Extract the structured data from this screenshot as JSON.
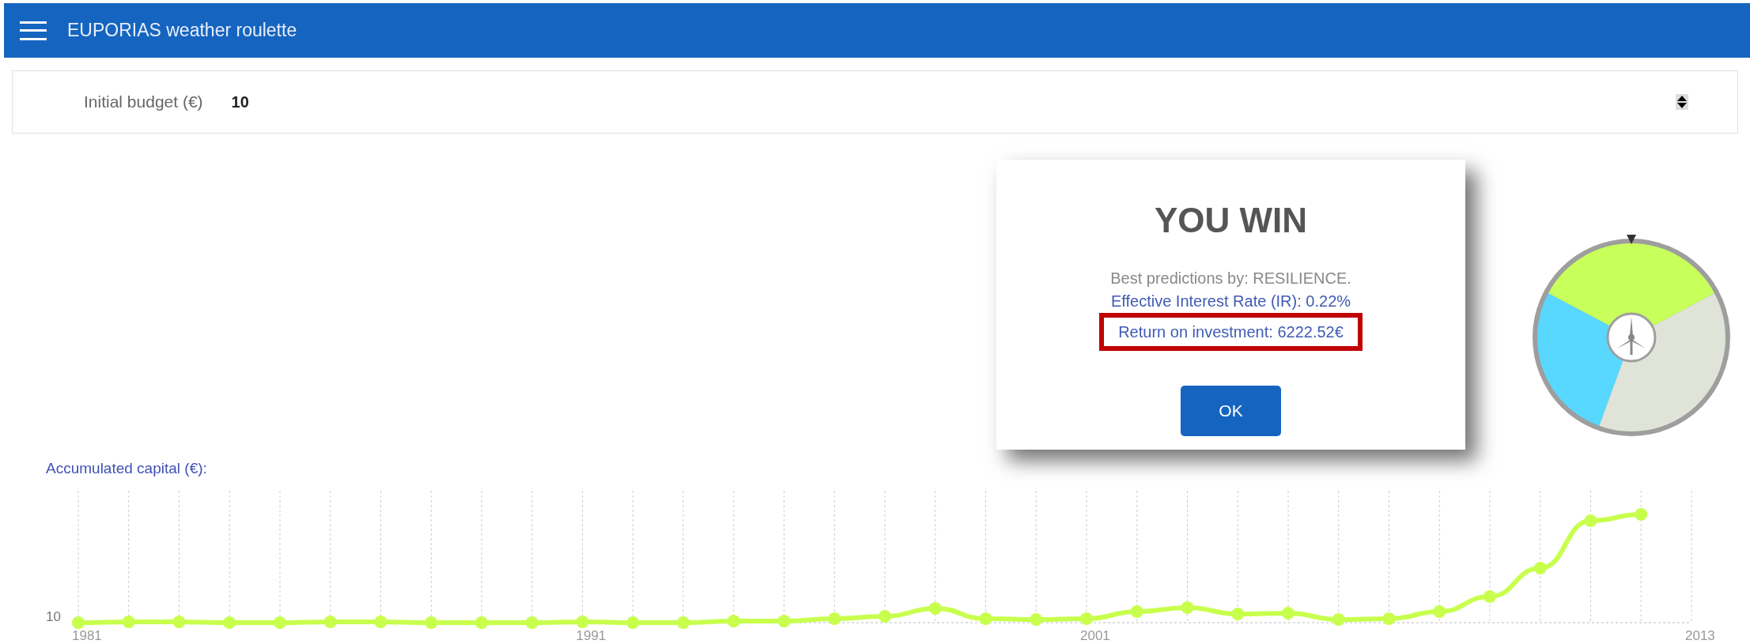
{
  "app_bar": {
    "title": "EUPORIAS weather roulette"
  },
  "budget": {
    "label": "Initial budget (€)",
    "value": "10"
  },
  "dialog": {
    "title": "YOU WIN",
    "lines": [
      {
        "text": "Best predictions by: RESILIENCE.",
        "kind": "note",
        "highlighted": false
      },
      {
        "text": "Effective Interest Rate (IR): 0.22%",
        "kind": "link",
        "highlighted": false
      },
      {
        "text": "Return on investment: 6222.52€",
        "kind": "link",
        "highlighted": true
      }
    ],
    "button": "OK"
  },
  "capital": {
    "label": "Accumulated capital (€):",
    "y_label": "10",
    "x_labels": [
      {
        "text": "1981"
      },
      {
        "text": "1991"
      },
      {
        "text": "2001"
      },
      {
        "text": "2013"
      }
    ]
  }
}
